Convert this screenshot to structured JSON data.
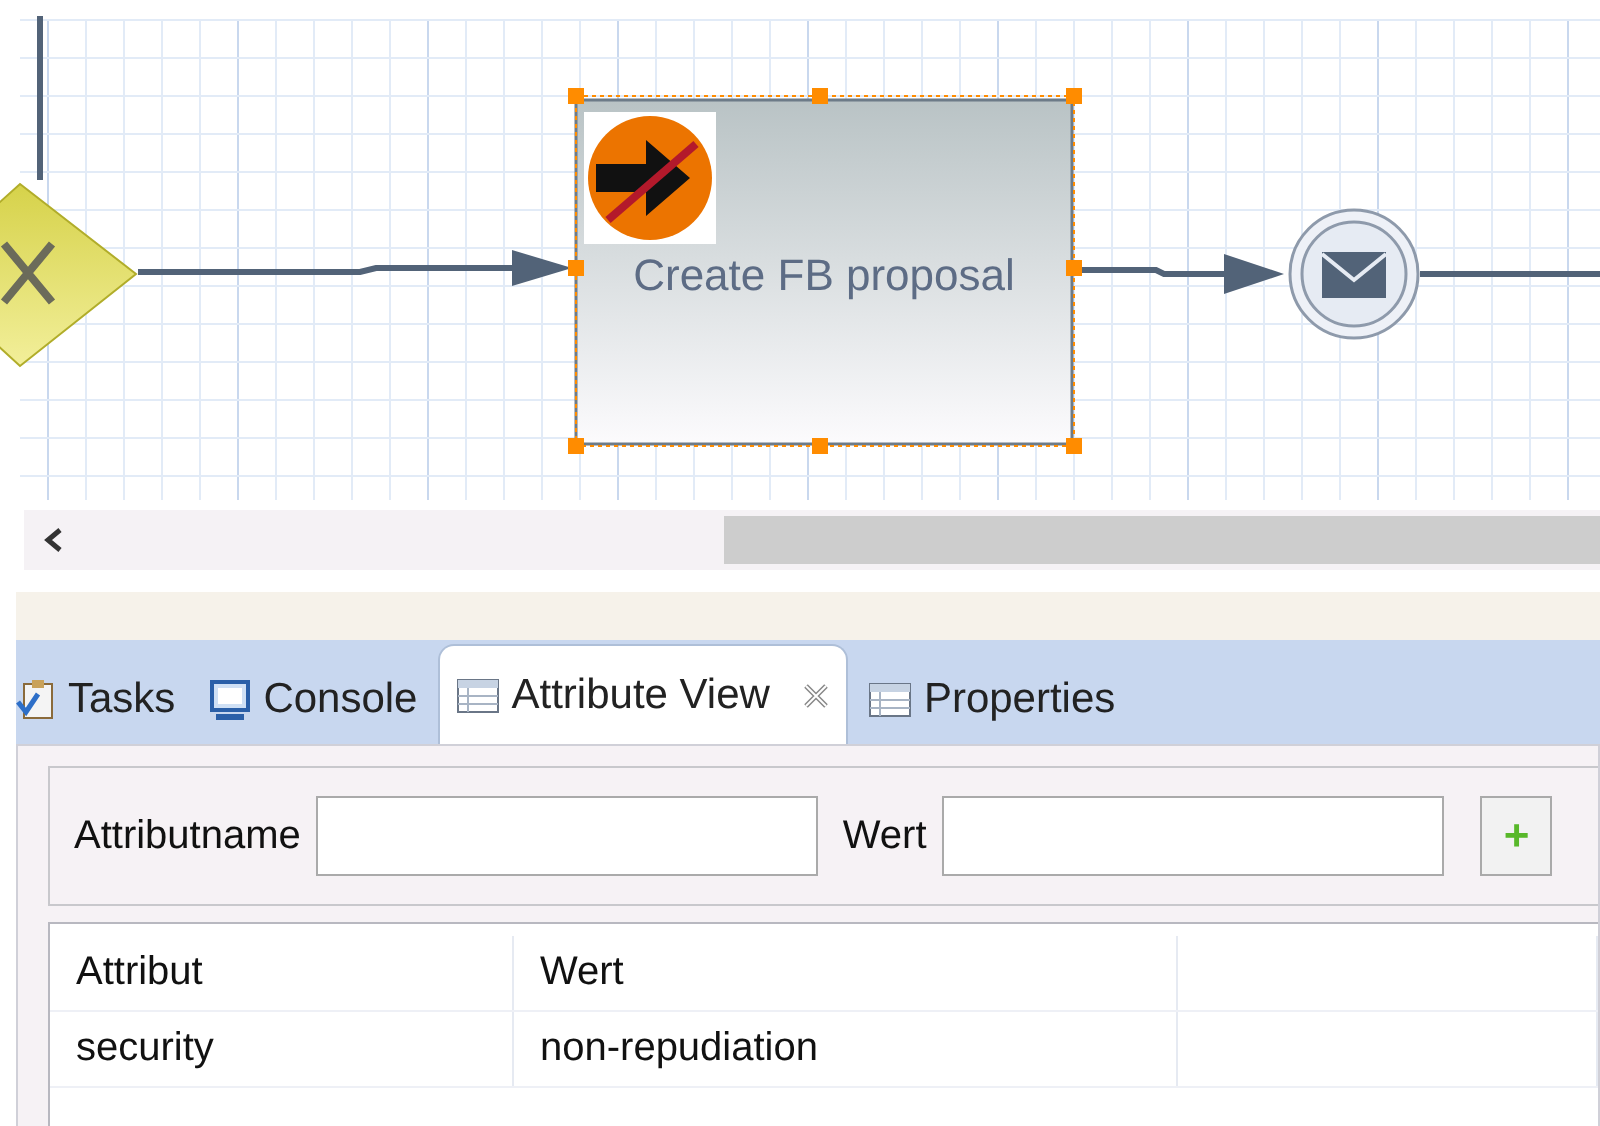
{
  "diagram": {
    "task": {
      "label": "Create FB proposal",
      "selected": true
    }
  },
  "tabs": [
    {
      "label": "Tasks",
      "kind": "tasks",
      "selected": false
    },
    {
      "label": "Console",
      "kind": "console",
      "selected": false
    },
    {
      "label": "Attribute View",
      "kind": "table",
      "selected": true
    },
    {
      "label": "Properties",
      "kind": "table",
      "selected": false
    }
  ],
  "filter": {
    "name_label": "Attributname",
    "value_label": "Wert",
    "add_button": "+"
  },
  "table": {
    "columns": [
      "Attribut",
      "Wert"
    ],
    "rows": [
      [
        "security",
        "non-repudiation"
      ]
    ]
  }
}
